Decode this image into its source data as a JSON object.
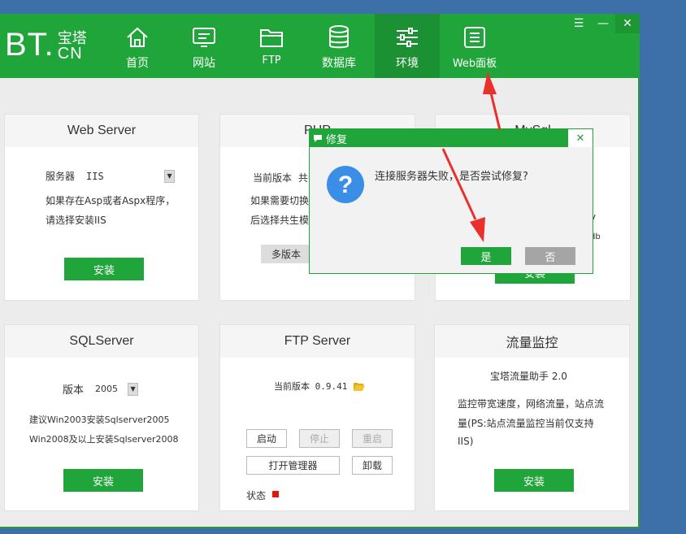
{
  "logo": {
    "bt": "BT.",
    "cn_top": "宝塔",
    "cn_bottom": "CN"
  },
  "nav": [
    {
      "label": "首页",
      "icon": "home-icon"
    },
    {
      "label": "网站",
      "icon": "monitor-icon"
    },
    {
      "label": "FTP",
      "icon": "folder-icon"
    },
    {
      "label": "数据库",
      "icon": "database-icon"
    },
    {
      "label": "环境",
      "icon": "sliders-icon",
      "active": true
    },
    {
      "label": "Web面板",
      "icon": "list-icon"
    }
  ],
  "window_buttons": {
    "menu": "☰",
    "minimize": "—",
    "close": "✕"
  },
  "cards": {
    "webserver": {
      "title": "Web Server",
      "select_label": "服务器",
      "select_value": "IIS",
      "desc1": "如果存在Asp或者Aspx程序，",
      "desc2": "请选择安装IIS",
      "button": "安装"
    },
    "php": {
      "title": "PHP",
      "version_label": "当前版本",
      "version_value": "共公",
      "desc1": "如果需要切换",
      "desc2": "后选择共生模",
      "button": "多版本"
    },
    "mysql": {
      "title": "MySql",
      "side1": "y",
      "side2": "db",
      "button": "安装"
    },
    "sqlserver": {
      "title": "SQLServer",
      "select_label": "版本",
      "select_value": "2005",
      "desc1": "建议Win2003安装Sqlserver2005",
      "desc2": "Win2008及以上安装Sqlserver2008",
      "button": "安装"
    },
    "ftp": {
      "title": "FTP Server",
      "version_text": "当前版本 0.9.41",
      "btn_start": "启动",
      "btn_stop": "停止",
      "btn_restart": "重启",
      "btn_manager": "打开管理器",
      "btn_uninstall": "卸载",
      "status_label": "状态",
      "status_color": "#e8120c"
    },
    "traffic": {
      "title": "流量监控",
      "subtitle": "宝塔流量助手 2.0",
      "desc1": "监控带宽速度，网络流量，站点流",
      "desc2": "量(PS:站点流量监控当前仅支持",
      "desc3": "IIS)",
      "button": "安装"
    }
  },
  "dialog": {
    "title": "修复",
    "message": "连接服务器失败，是否尝试修复?",
    "yes": "是",
    "no": "否",
    "close": "✕"
  },
  "colors": {
    "brand_green": "#20a53a",
    "arrow_red": "#e8312c",
    "desktop_blue": "#3d6fa8"
  }
}
